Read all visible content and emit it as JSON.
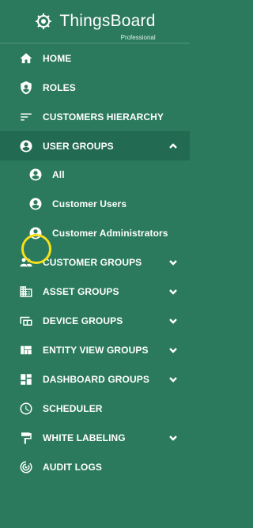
{
  "brand": {
    "name": "ThingsBoard",
    "edition": "Professional"
  },
  "menu": [
    {
      "label": "HOME",
      "icon": "home-icon"
    },
    {
      "label": "ROLES",
      "icon": "shield-icon"
    },
    {
      "label": "CUSTOMERS HIERARCHY",
      "icon": "sort-lines-icon"
    },
    {
      "label": "USER GROUPS",
      "icon": "account-circle-icon",
      "expanded": true,
      "children": [
        {
          "label": "All",
          "icon": "account-circle-icon"
        },
        {
          "label": "Customer Users",
          "icon": "account-circle-icon"
        },
        {
          "label": "Customer Administrators",
          "icon": "account-circle-icon",
          "highlighted": true
        }
      ]
    },
    {
      "label": "CUSTOMER GROUPS",
      "icon": "people-icon"
    },
    {
      "label": "ASSET GROUPS",
      "icon": "domain-icon"
    },
    {
      "label": "DEVICE GROUPS",
      "icon": "devices-icon"
    },
    {
      "label": "ENTITY VIEW GROUPS",
      "icon": "view-quilt-icon"
    },
    {
      "label": "DASHBOARD GROUPS",
      "icon": "dashboard-icon"
    },
    {
      "label": "SCHEDULER",
      "icon": "clock-icon"
    },
    {
      "label": "WHITE LABELING",
      "icon": "format-paint-icon"
    },
    {
      "label": "AUDIT LOGS",
      "icon": "track-changes-icon"
    }
  ],
  "colors": {
    "background": "#2b7a5e",
    "active_group": "#226a51",
    "highlight_ring": "#f7e01a"
  }
}
